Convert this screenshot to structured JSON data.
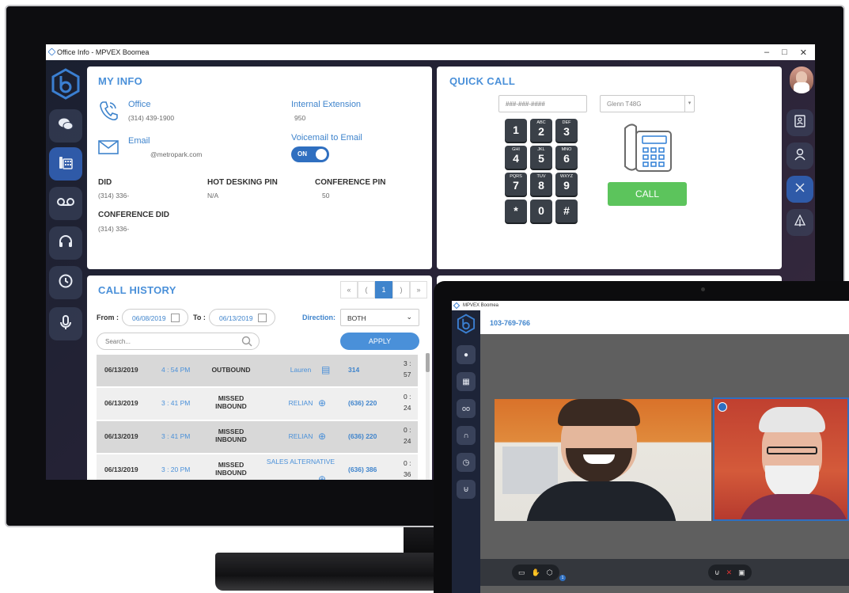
{
  "window": {
    "title": "Office Info - MPVEX Boomea",
    "minimize": "–",
    "maximize": "□",
    "close": "✕"
  },
  "sidebar": {
    "items": [
      {
        "name": "chat",
        "icon": "chat-bubbles-icon"
      },
      {
        "name": "office-info",
        "icon": "phone-grid-icon"
      },
      {
        "name": "voicemail",
        "icon": "voicemail-icon"
      },
      {
        "name": "support",
        "icon": "headset-icon"
      },
      {
        "name": "history",
        "icon": "clock-icon"
      },
      {
        "name": "recorder",
        "icon": "microphone-icon"
      }
    ]
  },
  "my_info": {
    "heading": "MY INFO",
    "office_label": "Office",
    "office_value": "(314) 439-1900",
    "email_label": "Email",
    "email_value": "@metropark.com",
    "ext_label": "Internal Extension",
    "ext_value": "950",
    "vm_label": "Voicemail to Email",
    "vm_toggle": "ON",
    "did_label": "DID",
    "did_value": "(314) 336-",
    "hotdesk_label": "HOT DESKING PIN",
    "hotdesk_value": "N/A",
    "conf_pin_label": "CONFERENCE PIN",
    "conf_pin_value": "50",
    "conf_did_label": "CONFERENCE DID",
    "conf_did_value": "(314) 336-"
  },
  "quick_call": {
    "heading": "QUICK CALL",
    "number_placeholder": "###-###-####",
    "device": "Glenn T48G",
    "call_label": "CALL",
    "keys": [
      {
        "n": "1",
        "s": ""
      },
      {
        "n": "2",
        "s": "ABC"
      },
      {
        "n": "3",
        "s": "DEF"
      },
      {
        "n": "4",
        "s": "GHI"
      },
      {
        "n": "5",
        "s": "JKL"
      },
      {
        "n": "6",
        "s": "MNO"
      },
      {
        "n": "7",
        "s": "PQRS"
      },
      {
        "n": "8",
        "s": "TUV"
      },
      {
        "n": "9",
        "s": "WXYZ"
      },
      {
        "n": "*",
        "s": ""
      },
      {
        "n": "0",
        "s": ""
      },
      {
        "n": "#",
        "s": ""
      }
    ]
  },
  "call_history": {
    "heading": "CALL HISTORY",
    "pager": {
      "first": "«",
      "prev": "(",
      "page": "1",
      "next": ")",
      "last": "»"
    },
    "from_label": "From :",
    "from_value": "06/08/2019",
    "to_label": "To :",
    "to_value": "06/13/2019",
    "direction_label": "Direction:",
    "direction_value": "BOTH",
    "search_placeholder": "Search...",
    "apply_label": "APPLY",
    "rows": [
      {
        "date": "06/13/2019",
        "time": "4 : 54 PM",
        "dir": "OUTBOUND",
        "name": "Lauren",
        "number": "314",
        "dur1": "3 :",
        "dur2": "57"
      },
      {
        "date": "06/13/2019",
        "time": "3 : 41 PM",
        "dir": "MISSED INBOUND",
        "name": "RELIAN",
        "number": "(636) 220",
        "dur1": "0 :",
        "dur2": "24"
      },
      {
        "date": "06/13/2019",
        "time": "3 : 41 PM",
        "dir": "MISSED INBOUND",
        "name": "RELIAN",
        "number": "(636) 220",
        "dur1": "0 :",
        "dur2": "24"
      },
      {
        "date": "06/13/2019",
        "time": "3 : 20 PM",
        "dir": "MISSED INBOUND",
        "name": "SALES ALTERNATIVE",
        "number": "(636) 386",
        "dur1": "0 :",
        "dur2": "36"
      }
    ]
  },
  "right_sidebar": {
    "items": [
      "contacts-card-icon",
      "user-icon",
      "close-icon",
      "tree-icon"
    ]
  },
  "laptop": {
    "title": "MPVEX Boomea",
    "meeting_id": "103-769-766",
    "badge": "1"
  },
  "colors": {
    "accent": "#4a90d9",
    "call_green": "#5cc45c",
    "active_nav": "#2f5aa8"
  }
}
